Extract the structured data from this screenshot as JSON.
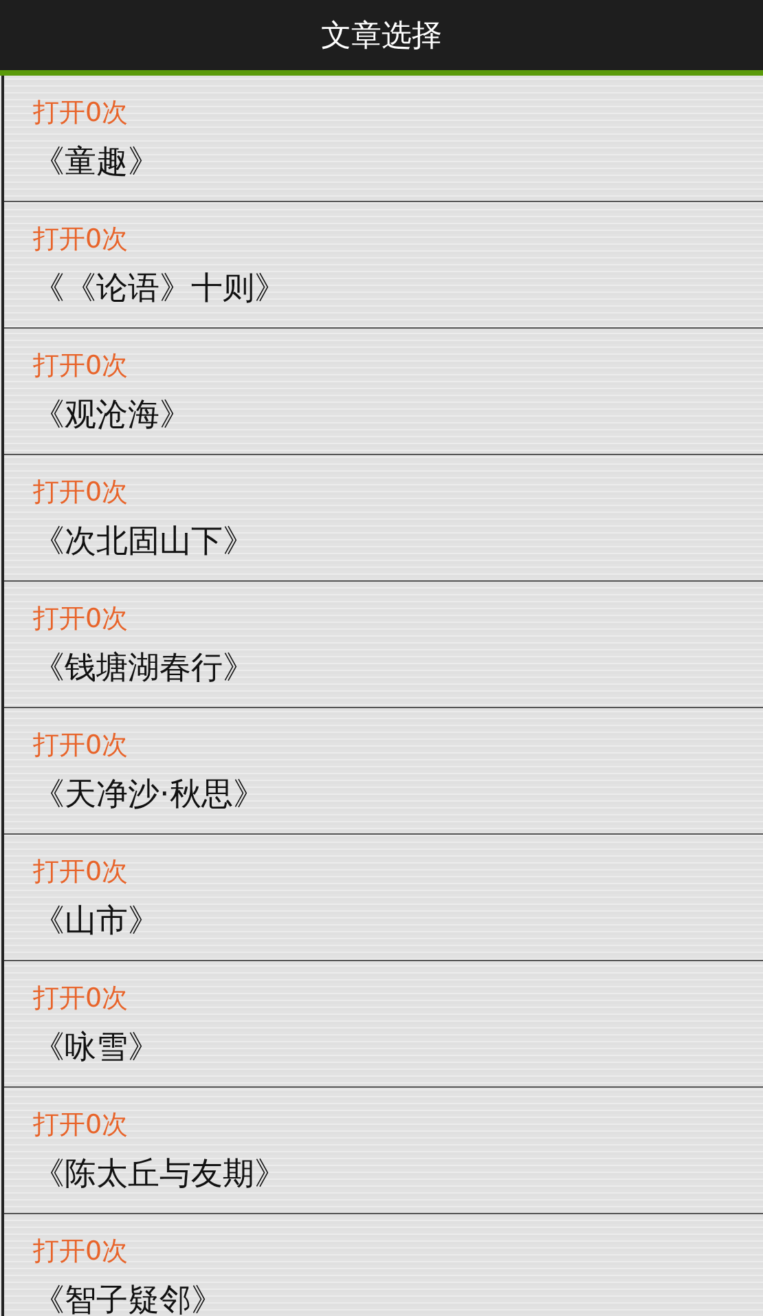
{
  "title": "文章选择",
  "articles": [
    {
      "count": "打开0次",
      "title": "《童趣》"
    },
    {
      "count": "打开0次",
      "title": "《《论语》十则》"
    },
    {
      "count": "打开0次",
      "title": "《观沧海》"
    },
    {
      "count": "打开0次",
      "title": "《次北固山下》"
    },
    {
      "count": "打开0次",
      "title": "《钱塘湖春行》"
    },
    {
      "count": "打开0次",
      "title": "《天净沙·秋思》"
    },
    {
      "count": "打开0次",
      "title": "《山市》"
    },
    {
      "count": "打开0次",
      "title": "《咏雪》"
    },
    {
      "count": "打开0次",
      "title": "《陈太丘与友期》"
    },
    {
      "count": "打开0次",
      "title": "《智子疑邻》"
    }
  ]
}
